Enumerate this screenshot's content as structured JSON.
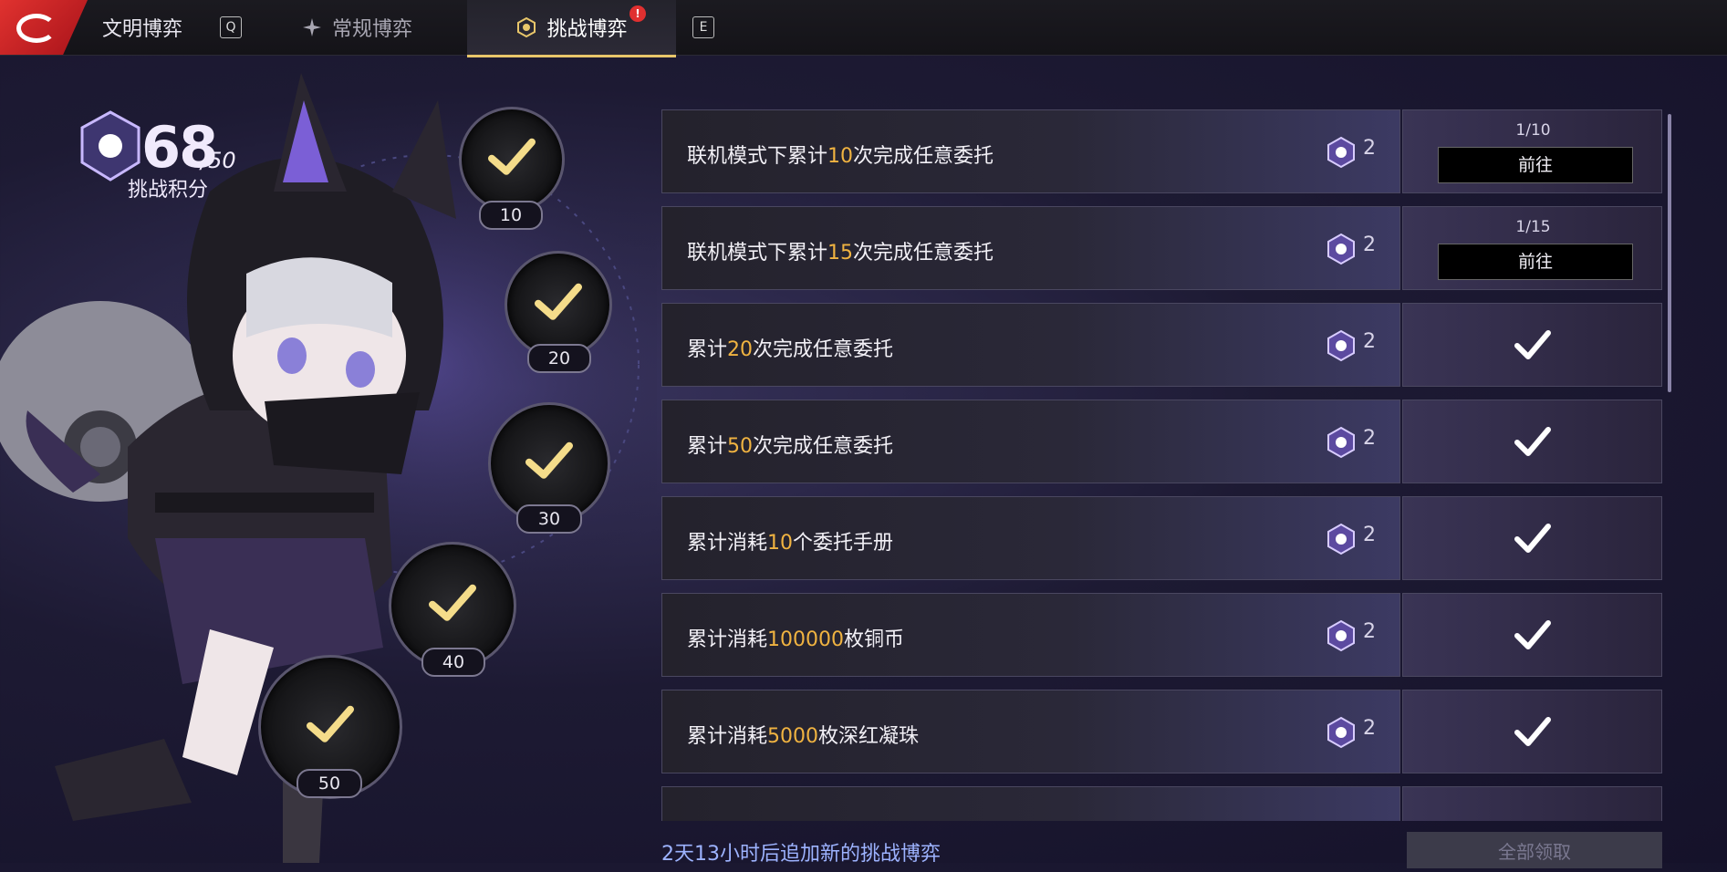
{
  "topbar": {
    "tabs": [
      {
        "label": "文明博弈",
        "key": "Q"
      },
      {
        "label": "常规博弈"
      },
      {
        "label": "挑战博弈",
        "badge": "!"
      },
      {
        "key": "E"
      }
    ]
  },
  "score": {
    "value": "68",
    "max": "/50",
    "label": "挑战积分"
  },
  "milestones": [
    "10",
    "20",
    "30",
    "40",
    "50"
  ],
  "tasks": [
    {
      "pre": "联机模式下累计",
      "num": "10",
      "post": "次完成任意委托",
      "reward": "2",
      "progress": "1/10",
      "action": "前往",
      "state": "go"
    },
    {
      "pre": "联机模式下累计",
      "num": "15",
      "post": "次完成任意委托",
      "reward": "2",
      "progress": "1/15",
      "action": "前往",
      "state": "go"
    },
    {
      "pre": "累计",
      "num": "20",
      "post": "次完成任意委托",
      "reward": "2",
      "state": "done"
    },
    {
      "pre": "累计",
      "num": "50",
      "post": "次完成任意委托",
      "reward": "2",
      "state": "done"
    },
    {
      "pre": "累计消耗",
      "num": "10",
      "post": "个委托手册",
      "reward": "2",
      "state": "done"
    },
    {
      "pre": "累计消耗",
      "num": "100000",
      "post": "枚铜币",
      "reward": "2",
      "state": "done"
    },
    {
      "pre": "累计消耗",
      "num": "5000",
      "post": "枚深红凝珠",
      "reward": "2",
      "state": "done"
    }
  ],
  "footer": {
    "refresh_text": "2天13小时后追加新的挑战博弈",
    "claim_all": "全部领取"
  },
  "colors": {
    "highlight": "#f0b341",
    "accent": "#e8c66a",
    "footer_text": "#9db3ff"
  }
}
